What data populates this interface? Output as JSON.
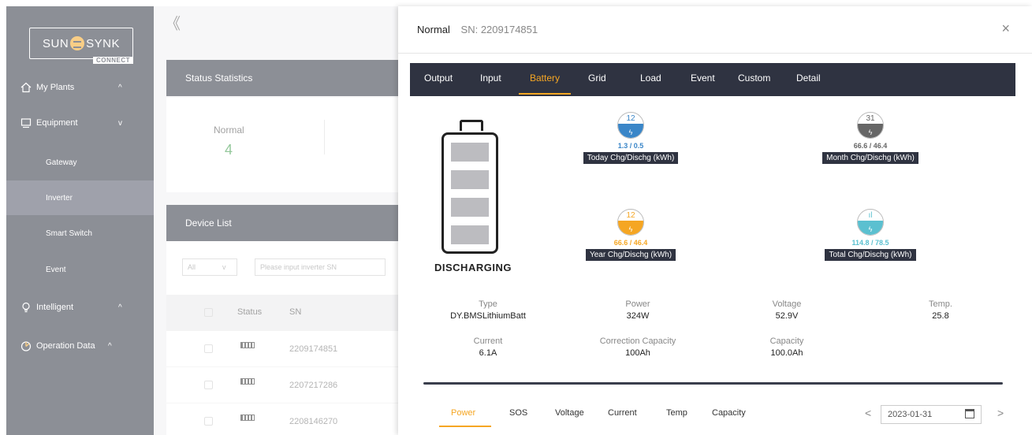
{
  "sidebar": {
    "brand": {
      "left": "SUN",
      "right": "SYNK",
      "sub": "CONNECT"
    },
    "items": [
      {
        "label": "My Plants",
        "icon": "home-icon",
        "chevron": "^"
      },
      {
        "label": "Equipment",
        "icon": "monitor-icon",
        "chevron": "v"
      },
      {
        "label": "Gateway"
      },
      {
        "label": "Inverter"
      },
      {
        "label": "Smart Switch"
      },
      {
        "label": "Event"
      },
      {
        "label": "Intelligent",
        "icon": "bulb-icon",
        "chevron": "^"
      },
      {
        "label": "Operation Data",
        "icon": "chart-icon",
        "chevron": "^"
      }
    ]
  },
  "background": {
    "collapse": "《",
    "status_title": "Status Statistics",
    "normal_label": "Normal",
    "normal_value": "4",
    "device_list_title": "Device List",
    "filter_all": "All",
    "filter_chevron": "v",
    "search_placeholder": "Please input inverter SN",
    "columns": {
      "status": "Status",
      "sn": "SN"
    },
    "rows": [
      "2209174851",
      "2207217286",
      "2208146270"
    ]
  },
  "modal": {
    "status": "Normal",
    "sn": "SN: 2209174851",
    "close": "×",
    "tabs": [
      "Output",
      "Input",
      "Battery",
      "Grid",
      "Load",
      "Event",
      "Custom",
      "Detail"
    ],
    "active_tab": "Battery",
    "battery_state": "DISCHARGING",
    "stats": [
      {
        "badge": "12",
        "value": "1.3 / 0.5",
        "caption": "Today Chg/Dischg (kWh)",
        "color": "#3a86c8"
      },
      {
        "badge": "31",
        "value": "66.6 / 46.4",
        "caption": "Month Chg/Dischg (kWh)",
        "color": "#666666"
      },
      {
        "badge": "12",
        "value": "66.6 / 46.4",
        "caption": "Year Chg/Dischg (kWh)",
        "color": "#f5a623"
      },
      {
        "badge": "ıl",
        "value": "114.8 / 78.5",
        "caption": "Total Chg/Dischg (kWh)",
        "color": "#5bc0d0"
      }
    ],
    "info": [
      {
        "key": "Type",
        "value": "DY.BMSLithiumBatt"
      },
      {
        "key": "Power",
        "value": "324W"
      },
      {
        "key": "Voltage",
        "value": "52.9V"
      },
      {
        "key": "Temp.",
        "value": "25.8"
      },
      {
        "key": "Current",
        "value": "6.1A"
      },
      {
        "key": "Correction Capacity",
        "value": "100Ah"
      },
      {
        "key": "Capacity",
        "value": "100.0Ah"
      }
    ],
    "subtabs": [
      "Power",
      "SOS",
      "Voltage",
      "Current",
      "Temp",
      "Capacity"
    ],
    "date": "2023-01-31",
    "prev": "<",
    "next": ">"
  }
}
